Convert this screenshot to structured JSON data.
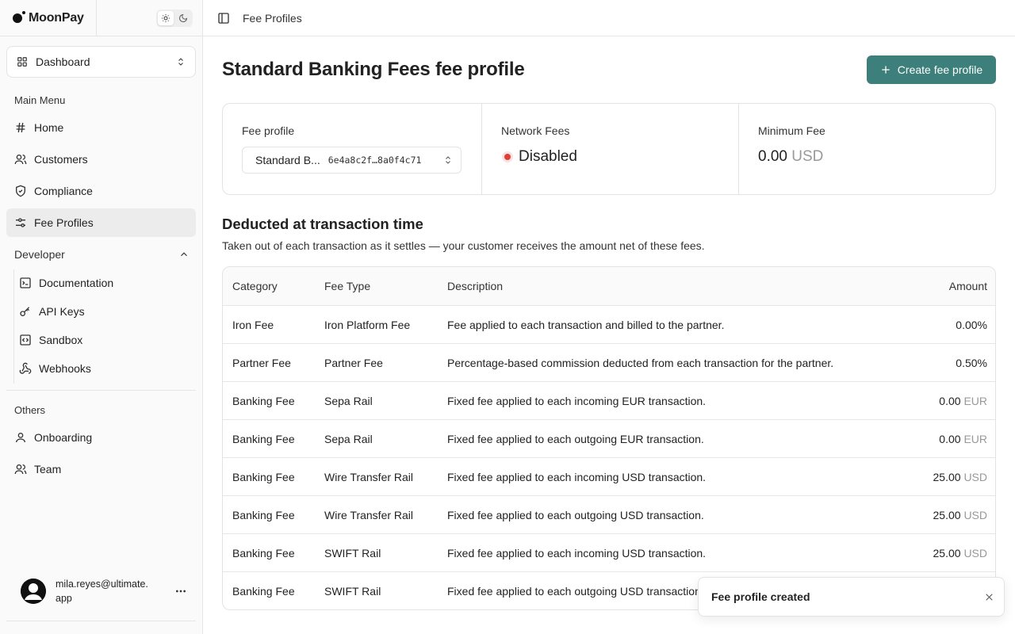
{
  "brand": {
    "name": "MoonPay"
  },
  "theme_toggle": {
    "light_icon": "sun-icon",
    "dark_icon": "moon-icon"
  },
  "workspace_select": {
    "label": "Dashboard"
  },
  "sidebar": {
    "main_menu_label": "Main Menu",
    "main_items": [
      {
        "label": "Home",
        "icon": "hash-icon"
      },
      {
        "label": "Customers",
        "icon": "users-icon"
      },
      {
        "label": "Compliance",
        "icon": "shield-check-icon"
      },
      {
        "label": "Fee Profiles",
        "icon": "sliders-icon",
        "active": true
      }
    ],
    "developer_label": "Developer",
    "developer_items": [
      {
        "label": "Documentation",
        "icon": "terminal-icon"
      },
      {
        "label": "API Keys",
        "icon": "key-icon"
      },
      {
        "label": "Sandbox",
        "icon": "code-icon"
      },
      {
        "label": "Webhooks",
        "icon": "webhook-icon"
      }
    ],
    "others_label": "Others",
    "other_items": [
      {
        "label": "Onboarding",
        "icon": "user-icon"
      },
      {
        "label": "Team",
        "icon": "users-icon"
      }
    ],
    "user": {
      "email": "mila.reyes@ultimate.app"
    }
  },
  "topbar": {
    "breadcrumb": "Fee Profiles"
  },
  "page": {
    "title": "Standard Banking Fees fee profile",
    "create_button": "Create fee profile"
  },
  "summary": {
    "profile_label": "Fee profile",
    "profile_name": "Standard B...",
    "profile_id": "6e4a8c2f…8a0f4c71",
    "network_label": "Network Fees",
    "network_status": "Disabled",
    "min_fee_label": "Minimum Fee",
    "min_fee_value": "0.00",
    "min_fee_unit": "USD"
  },
  "section": {
    "title": "Deducted at transaction time",
    "description": "Taken out of each transaction as it settles — your customer receives the amount net of these fees."
  },
  "table": {
    "columns": {
      "category": "Category",
      "fee_type": "Fee Type",
      "description": "Description",
      "amount": "Amount"
    },
    "rows": [
      {
        "category": "Iron Fee",
        "fee_type": "Iron Platform Fee",
        "description": "Fee applied to each transaction and billed to the partner.",
        "amount": "0.00%",
        "unit": ""
      },
      {
        "category": "Partner Fee",
        "fee_type": "Partner Fee",
        "description": "Percentage-based commission deducted from each transaction for the partner.",
        "amount": "0.50%",
        "unit": ""
      },
      {
        "category": "Banking Fee",
        "fee_type": "Sepa Rail",
        "description": "Fixed fee applied to each incoming EUR transaction.",
        "amount": "0.00",
        "unit": "EUR"
      },
      {
        "category": "Banking Fee",
        "fee_type": "Sepa Rail",
        "description": "Fixed fee applied to each outgoing EUR transaction.",
        "amount": "0.00",
        "unit": "EUR"
      },
      {
        "category": "Banking Fee",
        "fee_type": "Wire Transfer Rail",
        "description": "Fixed fee applied to each incoming USD transaction.",
        "amount": "25.00",
        "unit": "USD"
      },
      {
        "category": "Banking Fee",
        "fee_type": "Wire Transfer Rail",
        "description": "Fixed fee applied to each outgoing USD transaction.",
        "amount": "25.00",
        "unit": "USD"
      },
      {
        "category": "Banking Fee",
        "fee_type": "SWIFT Rail",
        "description": "Fixed fee applied to each incoming USD transaction.",
        "amount": "25.00",
        "unit": "USD"
      },
      {
        "category": "Banking Fee",
        "fee_type": "SWIFT Rail",
        "description": "Fixed fee applied to each outgoing USD transaction.",
        "amount": "",
        "unit": ""
      }
    ]
  },
  "toast": {
    "message": "Fee profile created"
  },
  "colors": {
    "accent": "#3d7f7b",
    "status_disabled": "#d9423c"
  }
}
